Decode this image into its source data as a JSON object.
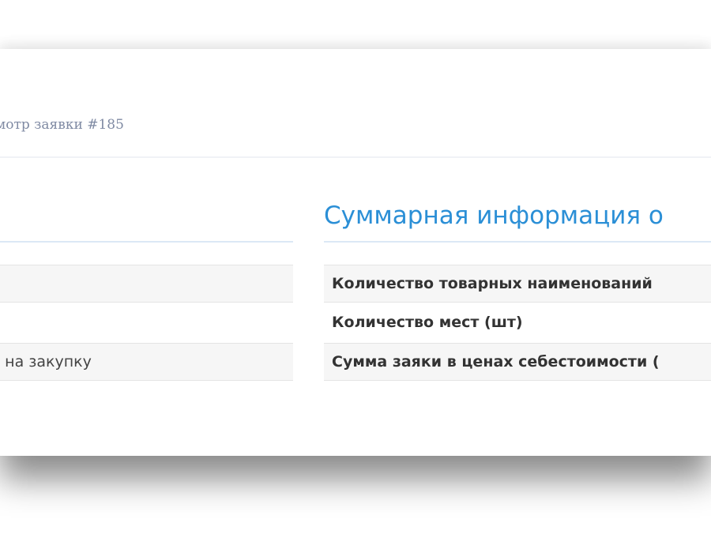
{
  "header": {
    "breadcrumb": "мотр заявки #185"
  },
  "details": {
    "rows": [
      {
        "value": ""
      },
      {
        "value": ""
      },
      {
        "value": "з на закупку"
      }
    ]
  },
  "summary": {
    "title": "Суммарная информация о",
    "rows": [
      {
        "label": "Количество товарных наименований"
      },
      {
        "label": "Количество мест (шт)"
      },
      {
        "label": "Сумма заяки в ценах себестоимости ("
      }
    ]
  }
}
